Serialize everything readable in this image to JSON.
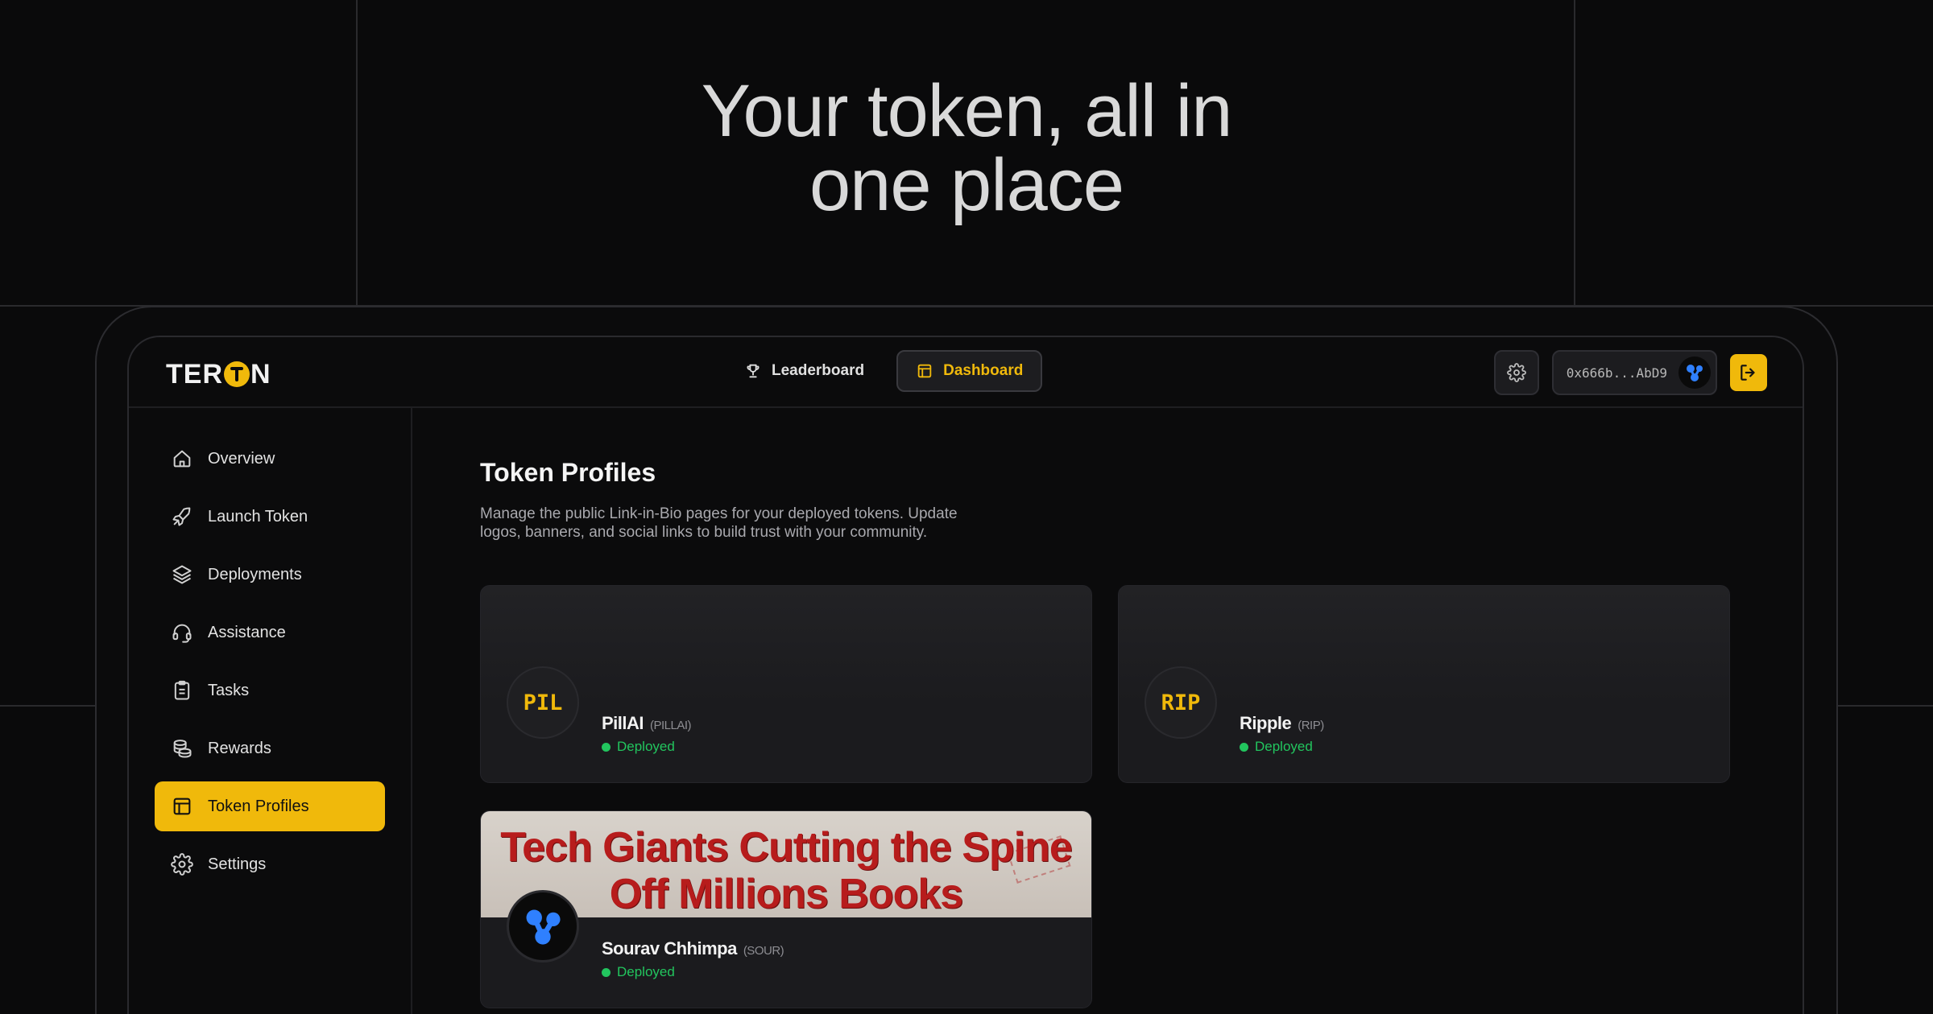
{
  "hero": {
    "line1": "Your token, all in",
    "line2": "one place"
  },
  "app": {
    "logo": {
      "prefix": "TER",
      "suffix": "N"
    },
    "nav": [
      {
        "label": "Leaderboard",
        "icon": "trophy-icon",
        "active": false
      },
      {
        "label": "Dashboard",
        "icon": "layout-icon",
        "active": true
      }
    ],
    "wallet": {
      "address": "0x666b...AbD9",
      "chain_icon": "ripple-icon"
    },
    "accent": "#f0b90b"
  },
  "sidebar": {
    "items": [
      {
        "label": "Overview",
        "icon": "home-icon"
      },
      {
        "label": "Launch Token",
        "icon": "rocket-icon"
      },
      {
        "label": "Deployments",
        "icon": "layers-icon"
      },
      {
        "label": "Assistance",
        "icon": "headset-icon"
      },
      {
        "label": "Tasks",
        "icon": "clipboard-icon"
      },
      {
        "label": "Rewards",
        "icon": "coins-icon"
      },
      {
        "label": "Token Profiles",
        "icon": "layout-icon",
        "active": true
      },
      {
        "label": "Settings",
        "icon": "gear-icon"
      }
    ]
  },
  "main": {
    "title": "Token Profiles",
    "description": "Manage the public Link-in-Bio pages for your deployed tokens. Update logos, banners, and social links to build trust with your community.",
    "cards": [
      {
        "avatar_text": "PIL",
        "name": "PillAI",
        "symbol": "(PILLAI)",
        "status": "Deployed"
      },
      {
        "avatar_text": "RIP",
        "name": "Ripple",
        "symbol": "(RIP)",
        "status": "Deployed"
      },
      {
        "name": "Sourav Chhimpa",
        "symbol": "(SOUR)",
        "status": "Deployed",
        "banner_headline": "Tech Giants Cutting the Spine Off Millions Books"
      }
    ]
  }
}
